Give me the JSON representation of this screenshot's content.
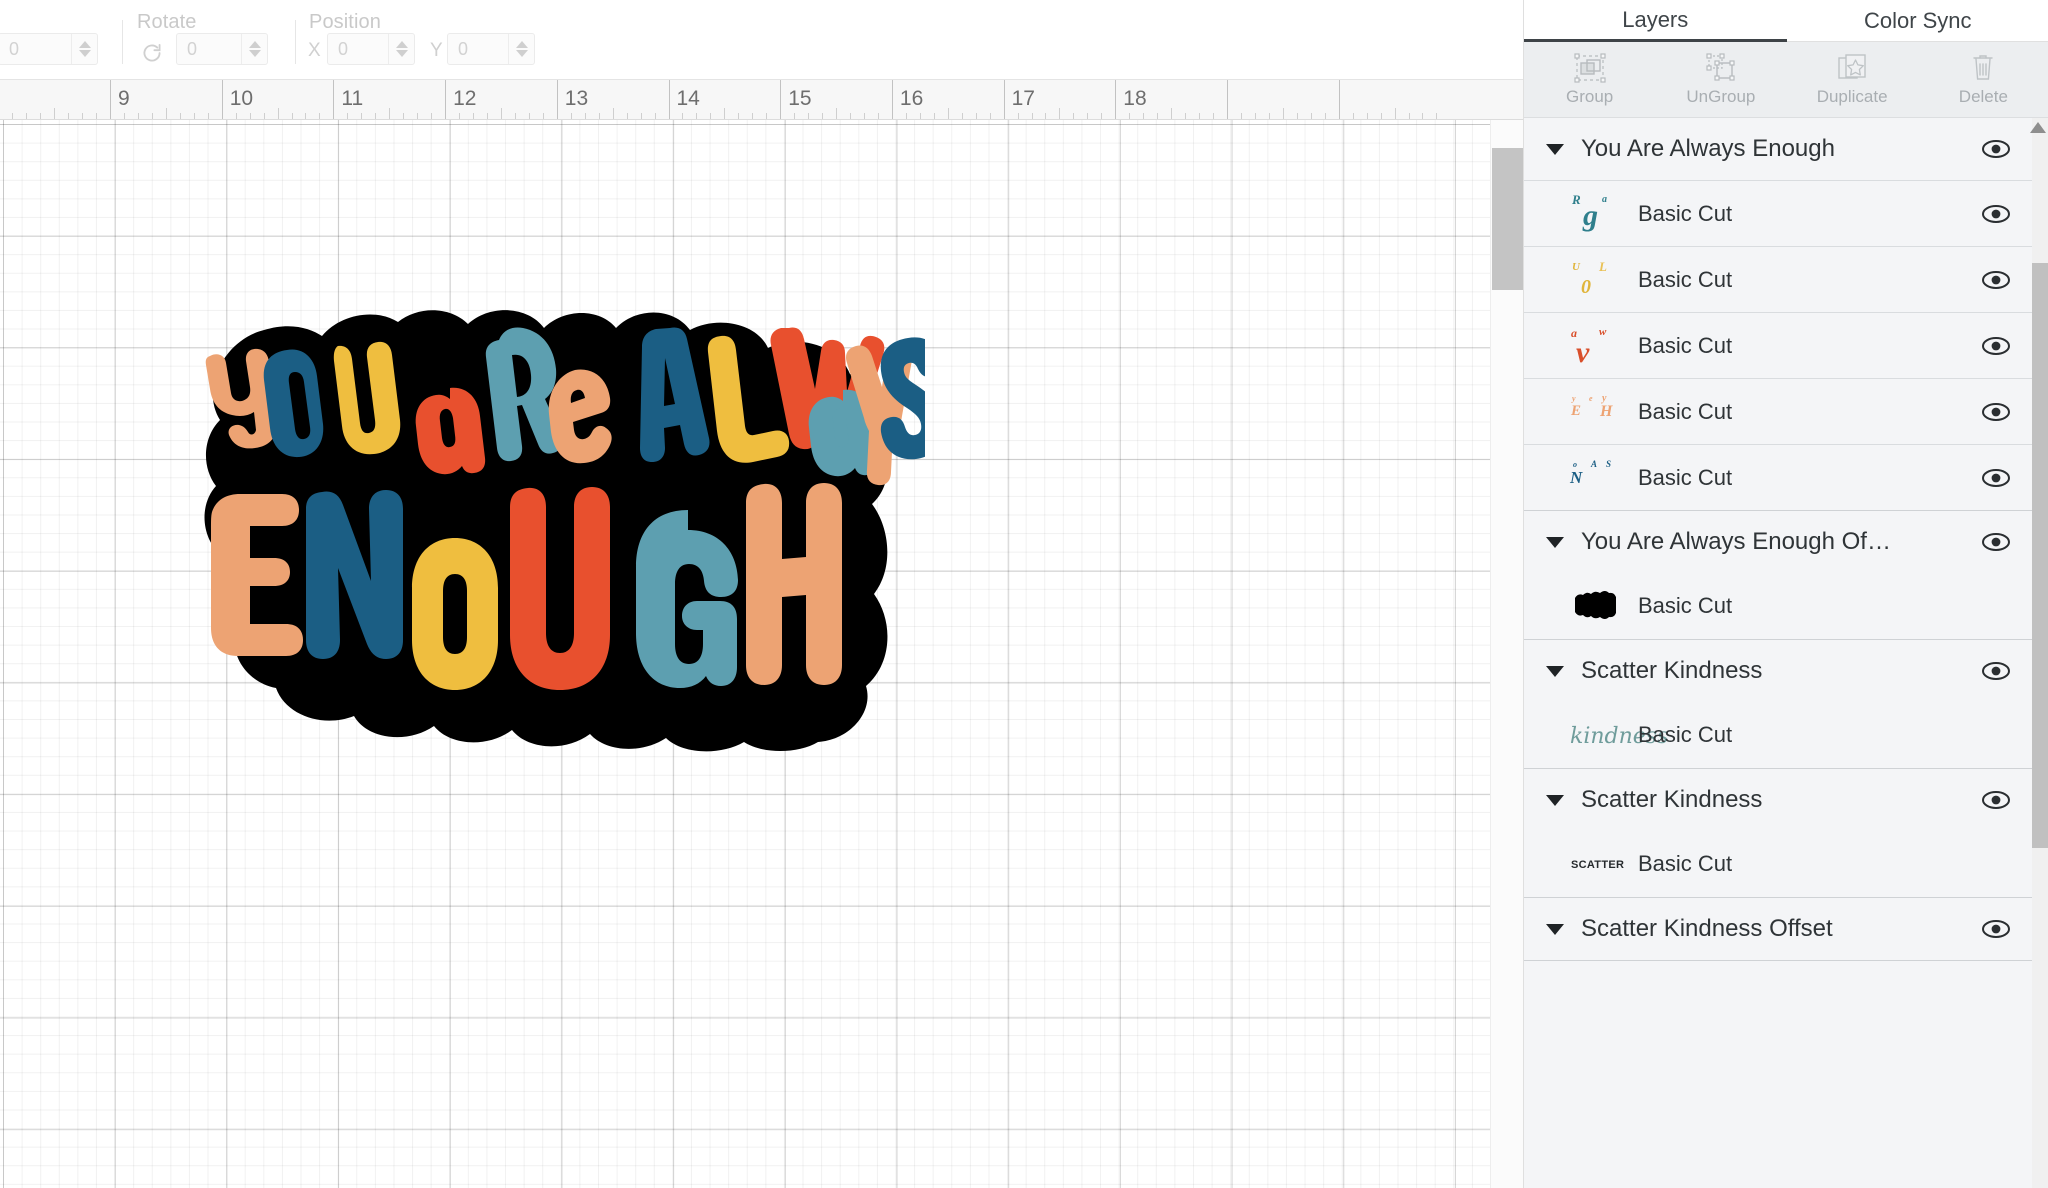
{
  "toolbar": {
    "size_value": "0",
    "rotate_label": "Rotate",
    "rotate_value": "0",
    "position_label": "Position",
    "x_letter": "X",
    "x_value": "0",
    "y_letter": "Y",
    "y_value": "0"
  },
  "ruler": {
    "unit_numbers": [
      "9",
      "10",
      "11",
      "12",
      "13",
      "14",
      "15",
      "16",
      "17",
      "18"
    ]
  },
  "artwork": {
    "line1": "YOU aRE ALWaYS",
    "line2": "ENOUGH",
    "outline_color": "#000000",
    "palette": {
      "peach": "#eda373",
      "blue": "#1b5e84",
      "yellow": "#efbe3f",
      "orange": "#e8502e",
      "teal": "#5d9fb0"
    },
    "letters_line1": [
      {
        "char": "Y",
        "color": "#eda373"
      },
      {
        "char": "O",
        "color": "#1b5e84"
      },
      {
        "char": "U",
        "color": "#efbe3f"
      },
      {
        "char": "a",
        "color": "#e8502e"
      },
      {
        "char": "R",
        "color": "#5d9fb0"
      },
      {
        "char": "E",
        "color": "#eda373"
      },
      {
        "char": "A",
        "color": "#1b5e84"
      },
      {
        "char": "L",
        "color": "#efbe3f"
      },
      {
        "char": "W",
        "color": "#e8502e"
      },
      {
        "char": "a",
        "color": "#5d9fb0"
      },
      {
        "char": "Y",
        "color": "#eda373"
      },
      {
        "char": "S",
        "color": "#1b5e84"
      }
    ],
    "letters_line2": [
      {
        "char": "E",
        "color": "#eda373"
      },
      {
        "char": "N",
        "color": "#1b5e84"
      },
      {
        "char": "O",
        "color": "#efbe3f"
      },
      {
        "char": "U",
        "color": "#e8502e"
      },
      {
        "char": "G",
        "color": "#5d9fb0"
      },
      {
        "char": "H",
        "color": "#eda373"
      }
    ]
  },
  "panel": {
    "tabs": [
      {
        "label": "Layers",
        "active": true
      },
      {
        "label": "Color Sync",
        "active": false
      }
    ],
    "actions": [
      {
        "label": "Group",
        "icon": "group-icon"
      },
      {
        "label": "UnGroup",
        "icon": "ungroup-icon"
      },
      {
        "label": "Duplicate",
        "icon": "duplicate-icon"
      },
      {
        "label": "Delete",
        "icon": "trash-icon"
      }
    ],
    "layer_groups": [
      {
        "title": "You Are Always Enough",
        "visibility_icon": "eye-icon",
        "children": [
          {
            "name": "Basic Cut",
            "thumb": "thumb-you-teal",
            "visibility_icon": "eye-icon"
          },
          {
            "name": "Basic Cut",
            "thumb": "thumb-you-yellow",
            "visibility_icon": "eye-icon"
          },
          {
            "name": "Basic Cut",
            "thumb": "thumb-you-orange",
            "visibility_icon": "eye-icon"
          },
          {
            "name": "Basic Cut",
            "thumb": "thumb-you-peach",
            "visibility_icon": "eye-icon"
          },
          {
            "name": "Basic Cut",
            "thumb": "thumb-you-blue",
            "visibility_icon": "eye-icon"
          }
        ]
      },
      {
        "title": "You Are Always Enough Of…",
        "visibility_icon": "eye-icon",
        "children": [
          {
            "name": "Basic Cut",
            "thumb": "thumb-black-blob",
            "visibility_icon": null
          }
        ]
      },
      {
        "title": "Scatter Kindness",
        "visibility_icon": "eye-icon",
        "children": [
          {
            "name": "Basic Cut",
            "thumb": "thumb-script",
            "visibility_icon": null
          }
        ]
      },
      {
        "title": "Scatter Kindness",
        "visibility_icon": "eye-icon",
        "children": [
          {
            "name": "Basic Cut",
            "thumb": "thumb-scatter-word",
            "visibility_icon": null
          }
        ]
      },
      {
        "title": "Scatter Kindness Offset",
        "visibility_icon": "eye-icon",
        "children": []
      }
    ]
  }
}
